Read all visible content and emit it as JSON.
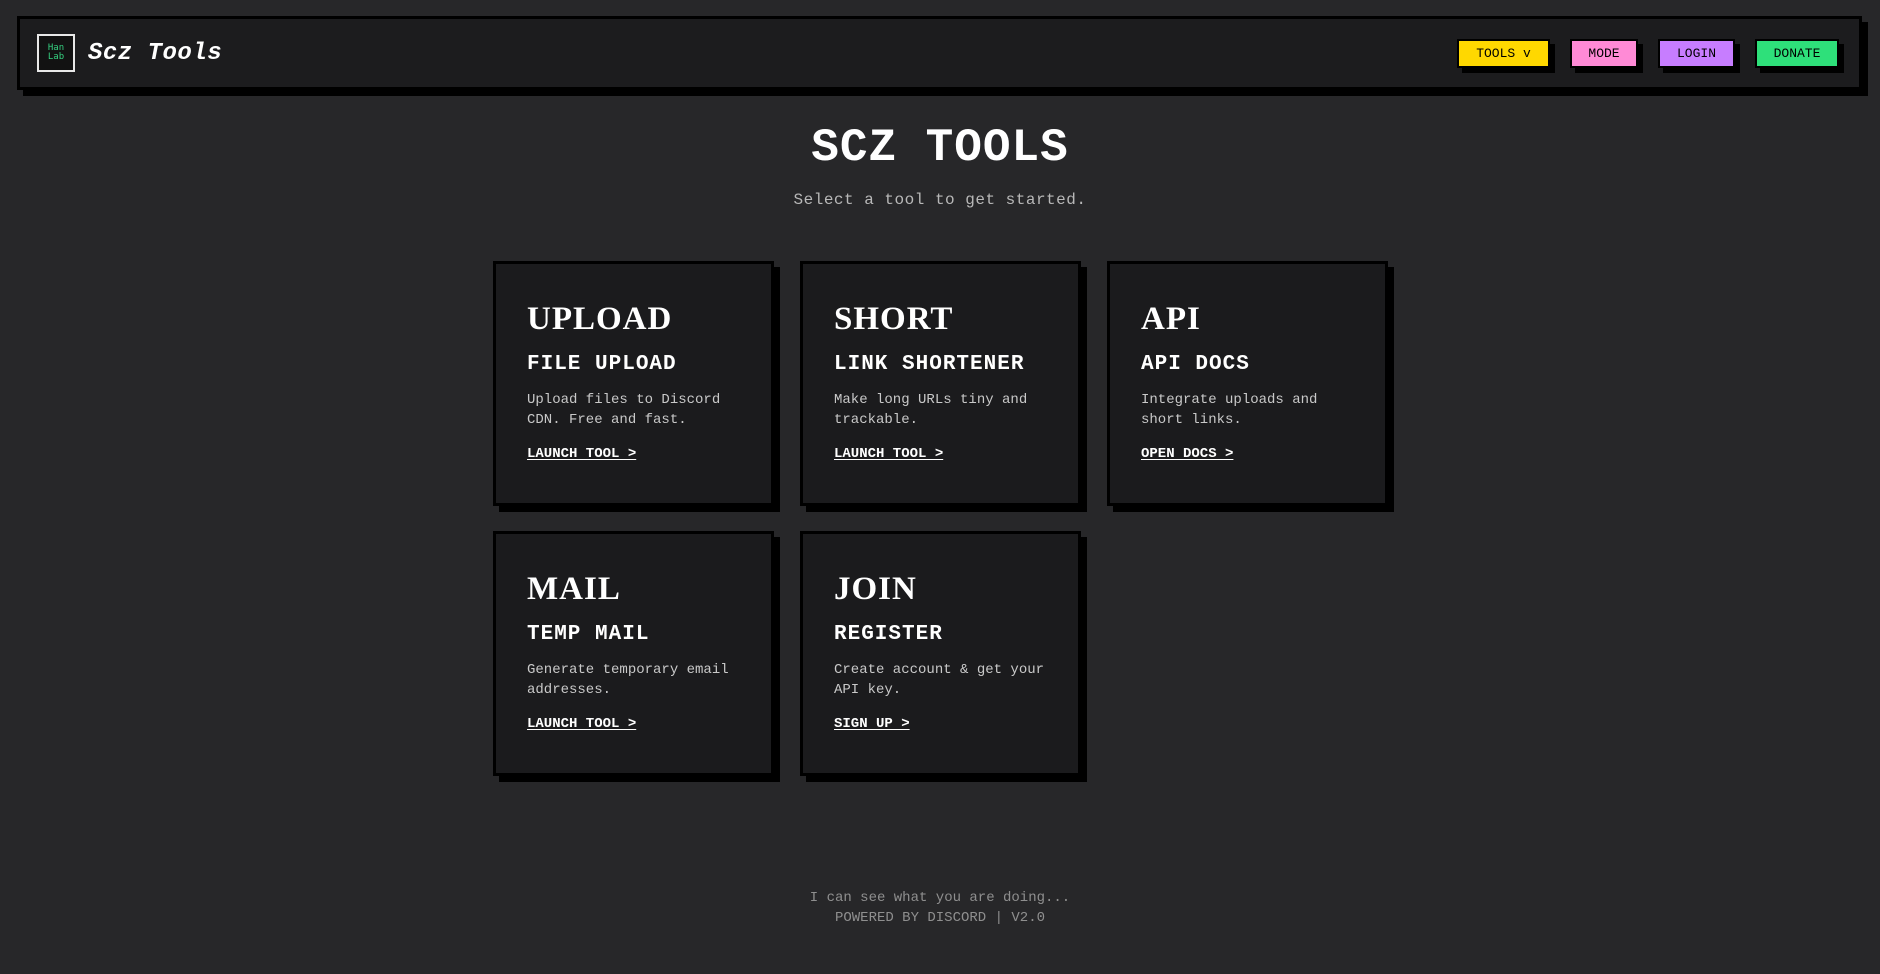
{
  "header": {
    "logo_text_top": "Han",
    "logo_text_bottom": "Lab",
    "brand": "Scz Tools",
    "nav": {
      "tools": "TOOLS v",
      "mode": "MODE",
      "login": "LOGIN",
      "donate": "DONATE"
    }
  },
  "colors": {
    "background": "#272729",
    "card": "#1b1b1d",
    "tools": "#ffd800",
    "mode": "#ff8ad6",
    "login": "#c77dff",
    "donate": "#2ee07a"
  },
  "hero": {
    "title": "SCZ TOOLS",
    "subtitle": "Select a tool to get started."
  },
  "cards": [
    {
      "tag": "UPLOAD",
      "title": "FILE UPLOAD",
      "desc": "Upload files to Discord CDN. Free and fast.",
      "link": "LAUNCH TOOL >"
    },
    {
      "tag": "SHORT",
      "title": "LINK SHORTENER",
      "desc": "Make long URLs tiny and trackable.",
      "link": "LAUNCH TOOL >"
    },
    {
      "tag": "API",
      "title": "API DOCS",
      "desc": "Integrate uploads and short links.",
      "link": "OPEN DOCS >"
    },
    {
      "tag": "MAIL",
      "title": "TEMP MAIL",
      "desc": "Generate temporary email addresses.",
      "link": "LAUNCH TOOL >"
    },
    {
      "tag": "JOIN",
      "title": "REGISTER",
      "desc": "Create account & get your API key.",
      "link": "SIGN UP >"
    }
  ],
  "footer": {
    "line1": "I can see what you are doing...",
    "line2": "POWERED BY DISCORD | V2.0"
  }
}
